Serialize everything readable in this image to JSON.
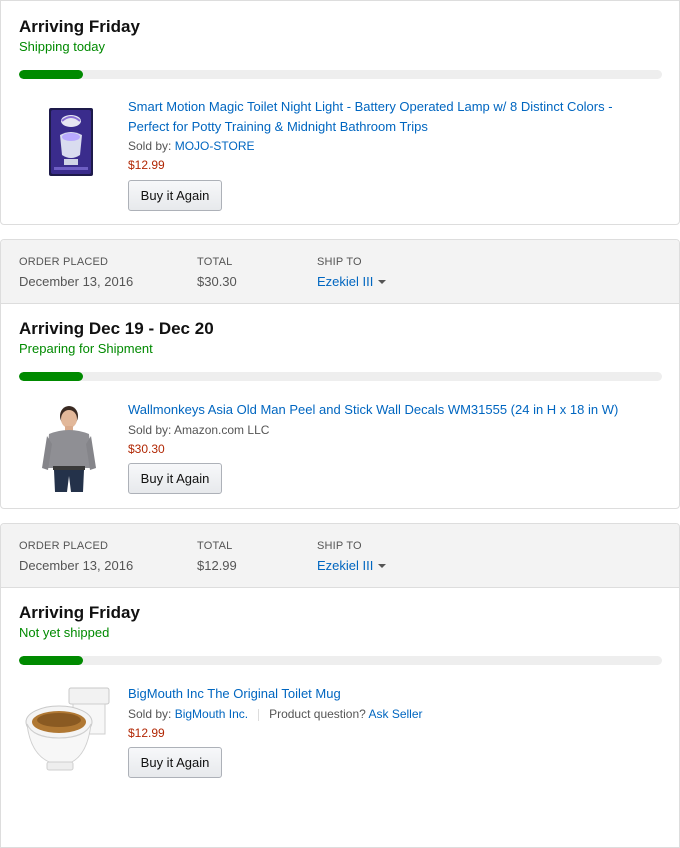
{
  "shipments": [
    {
      "arriving": "Arriving Friday",
      "status": "Shipping today",
      "progress": 0.1,
      "item": {
        "title": "Smart Motion Magic Toilet Night Light - Battery Operated Lamp w/ 8 Distinct Colors - Perfect for Potty Training & Midnight Bathroom Trips",
        "sold_by_label": "Sold by:",
        "seller": "MOJO-STORE",
        "price": "$12.99",
        "buy_again": "Buy it Again"
      }
    },
    {
      "order": {
        "placed_label": "ORDER PLACED",
        "placed": "December 13, 2016",
        "total_label": "TOTAL",
        "total": "$30.30",
        "ship_label": "SHIP TO",
        "ship_to": "Ezekiel III"
      },
      "arriving": "Arriving Dec 19 - Dec 20",
      "status": "Preparing for Shipment",
      "progress": 0.1,
      "item": {
        "title": "Wallmonkeys Asia Old Man Peel and Stick Wall Decals WM31555 (24 in H x 18 in W)",
        "sold_by_label": "Sold by:",
        "seller": "Amazon.com LLC",
        "price": "$30.30",
        "buy_again": "Buy it Again"
      }
    },
    {
      "order": {
        "placed_label": "ORDER PLACED",
        "placed": "December 13, 2016",
        "total_label": "TOTAL",
        "total": "$12.99",
        "ship_label": "SHIP TO",
        "ship_to": "Ezekiel III"
      },
      "arriving": "Arriving Friday",
      "status": "Not yet shipped",
      "progress": 0.1,
      "item": {
        "title": "BigMouth Inc The Original Toilet Mug",
        "sold_by_label": "Sold by:",
        "seller": "BigMouth Inc.",
        "question_label": "Product question?",
        "ask_seller": "Ask Seller",
        "price": "$12.99",
        "buy_again": "Buy it Again"
      }
    }
  ],
  "colors": {
    "accent_link": "#0066c0",
    "status_green": "#008a00",
    "price_red": "#b12704",
    "header_bg": "#f3f3f3"
  }
}
